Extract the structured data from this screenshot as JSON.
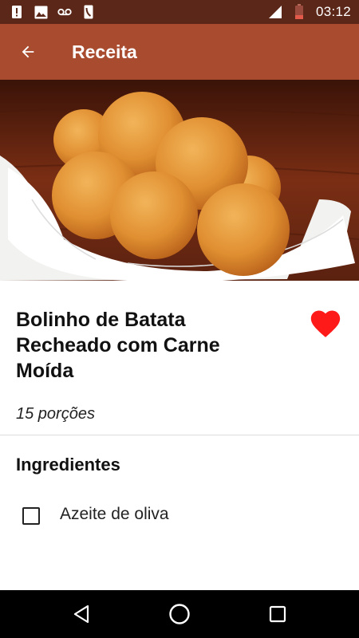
{
  "status_bar": {
    "time": "03:12",
    "icons": [
      "alert-icon",
      "image-icon",
      "voicemail-icon",
      "phone-icon",
      "signal-icon",
      "battery-icon"
    ]
  },
  "app_bar": {
    "title": "Receita",
    "back_icon": "arrow-back-icon"
  },
  "hero_image": {
    "subject": "fried potato croquettes on a white napkin"
  },
  "recipe": {
    "title": "Bolinho de Batata Recheado com Carne Moída",
    "servings": "15 porções",
    "favorite": true
  },
  "ingredients_section": {
    "title": "Ingredientes",
    "items": [
      {
        "label": "Azeite de oliva",
        "checked": false
      }
    ]
  },
  "nav_bar": {
    "buttons": [
      "back-triangle-icon",
      "home-circle-icon",
      "recents-square-icon"
    ]
  },
  "colors": {
    "status_bar": "#5b2718",
    "app_bar": "#a84b2f",
    "favorite": "#ff1a1a",
    "nav_bar": "#000000"
  }
}
